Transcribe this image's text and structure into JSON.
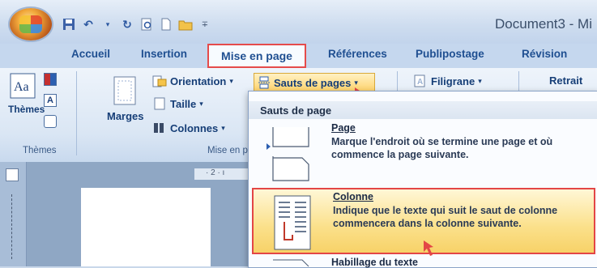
{
  "window": {
    "doc_title": "Document3 - Mi"
  },
  "tabs": [
    {
      "label": "Accueil"
    },
    {
      "label": "Insertion"
    },
    {
      "label": "Mise en page"
    },
    {
      "label": "Références"
    },
    {
      "label": "Publipostage"
    },
    {
      "label": "Révision"
    }
  ],
  "ribbon": {
    "themes": {
      "button": "Thèmes",
      "group_label": "Thèmes"
    },
    "marges": "Marges",
    "orientation": "Orientation",
    "taille": "Taille",
    "colonnes": "Colonnes",
    "sauts": "Sauts de pages",
    "filigrane": "Filigrane",
    "retrait": "Retrait",
    "mise_group_label": "Mise en p",
    "ruler_text": "· 2 · ı"
  },
  "dropdown": {
    "header": "Sauts de page",
    "items": [
      {
        "title": "Page",
        "desc": "Marque l'endroit où se termine une page et où commence la page suivante."
      },
      {
        "title": "Colonne",
        "desc": "Indique que le texte qui suit le saut de colonne commencera dans la colonne suivante."
      },
      {
        "title": "Habillage du texte"
      }
    ]
  },
  "colors": {
    "highlight": "#fbe08a",
    "annotation": "#e34646",
    "tab_text": "#1f4f91"
  }
}
